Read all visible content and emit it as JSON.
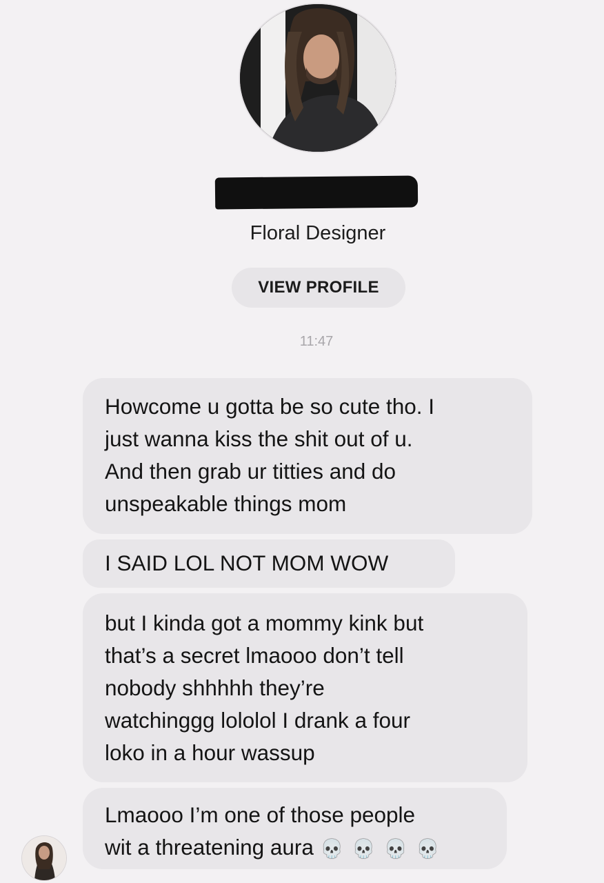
{
  "profile": {
    "subtitle": "Floral Designer",
    "view_profile_label": "VIEW PROFILE"
  },
  "thread": {
    "timestamp": "11:47",
    "messages": [
      {
        "text": "Howcome u gotta be so cute tho. I\njust wanna kiss the shit out of u.\nAnd then grab ur titties and do\nunspeakable things mom"
      },
      {
        "text": "I SAID LOL NOT MOM WOW"
      },
      {
        "text": "but I kinda got a mommy kink but\nthat’s a secret lmaooo don’t tell\nnobody shhhhh they’re\nwatchinggg lololol I drank  a four\nloko in a hour wassup"
      },
      {
        "text": "Lmaooo I’m one of those people\nwit a threatening aura",
        "emoji": "💀💀💀💀"
      }
    ]
  },
  "icons": {
    "profile_photo": "person-photo",
    "sender_avatar": "person-photo",
    "skull": "skull-emoji"
  }
}
